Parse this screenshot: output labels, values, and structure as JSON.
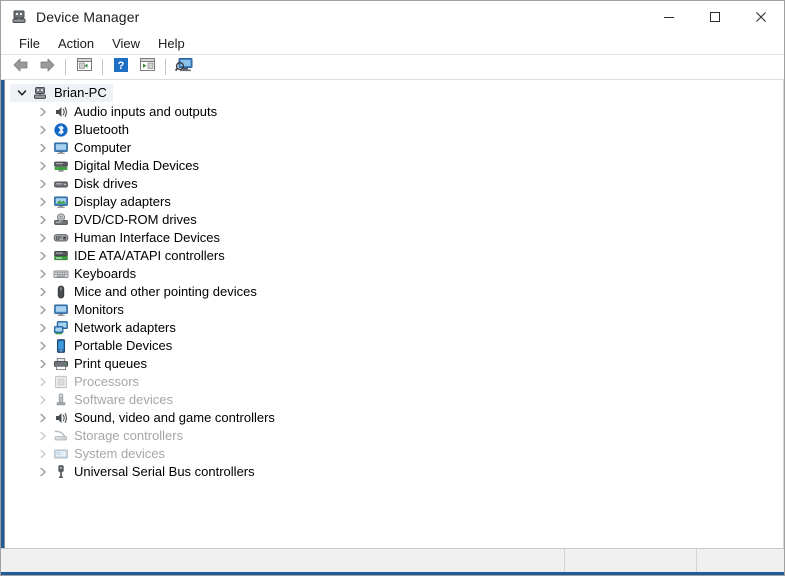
{
  "window": {
    "title": "Device Manager",
    "title_icon": "computer-icon",
    "caption": {
      "minimize": "minimize-icon",
      "maximize": "maximize-icon",
      "close": "close-icon"
    }
  },
  "menubar": {
    "items": [
      {
        "label": "File"
      },
      {
        "label": "Action"
      },
      {
        "label": "View"
      },
      {
        "label": "Help"
      }
    ]
  },
  "toolbar": {
    "buttons": [
      {
        "name": "back-button",
        "icon": "arrow-left-icon"
      },
      {
        "name": "forward-button",
        "icon": "arrow-right-icon"
      },
      {
        "name": "properties-button",
        "icon": "properties-icon"
      },
      {
        "name": "help-button",
        "icon": "help-icon"
      },
      {
        "name": "update-driver-button",
        "icon": "update-driver-icon"
      },
      {
        "name": "scan-hardware-button",
        "icon": "scan-hardware-icon"
      }
    ]
  },
  "tree": {
    "root": {
      "label": "Brian-PC",
      "icon": "computer-icon",
      "expanded": true,
      "selected": true
    },
    "items": [
      {
        "label": "Audio inputs and outputs",
        "icon": "speaker-icon",
        "dim": false
      },
      {
        "label": "Bluetooth",
        "icon": "bluetooth-icon",
        "dim": false
      },
      {
        "label": "Computer",
        "icon": "monitor-icon",
        "dim": false
      },
      {
        "label": "Digital Media Devices",
        "icon": "media-device-icon",
        "dim": false
      },
      {
        "label": "Disk drives",
        "icon": "disk-drive-icon",
        "dim": false
      },
      {
        "label": "Display adapters",
        "icon": "display-adapter-icon",
        "dim": false
      },
      {
        "label": "DVD/CD-ROM drives",
        "icon": "optical-drive-icon",
        "dim": false
      },
      {
        "label": "Human Interface Devices",
        "icon": "hid-icon",
        "dim": false
      },
      {
        "label": "IDE ATA/ATAPI controllers",
        "icon": "ide-controller-icon",
        "dim": false
      },
      {
        "label": "Keyboards",
        "icon": "keyboard-icon",
        "dim": false
      },
      {
        "label": "Mice and other pointing devices",
        "icon": "mouse-icon",
        "dim": false
      },
      {
        "label": "Monitors",
        "icon": "monitor-icon",
        "dim": false
      },
      {
        "label": "Network adapters",
        "icon": "network-adapter-icon",
        "dim": false
      },
      {
        "label": "Portable Devices",
        "icon": "portable-device-icon",
        "dim": false
      },
      {
        "label": "Print queues",
        "icon": "printer-icon",
        "dim": false
      },
      {
        "label": "Processors",
        "icon": "processor-icon",
        "dim": true
      },
      {
        "label": "Software devices",
        "icon": "software-device-icon",
        "dim": true
      },
      {
        "label": "Sound, video and game controllers",
        "icon": "speaker-icon",
        "dim": false
      },
      {
        "label": "Storage controllers",
        "icon": "storage-controller-icon",
        "dim": true
      },
      {
        "label": "System devices",
        "icon": "system-device-icon",
        "dim": true
      },
      {
        "label": "Universal Serial Bus controllers",
        "icon": "usb-icon",
        "dim": false
      }
    ]
  },
  "statusbar": {
    "panes": [
      {
        "text": ""
      },
      {
        "text": ""
      },
      {
        "text": ""
      }
    ]
  },
  "colors": {
    "accent_border": "#1f5c99",
    "selection": "#eef2f6",
    "dim_text": "#a6a6a6",
    "text": "#000000",
    "status_bg": "#f0f0f0"
  }
}
